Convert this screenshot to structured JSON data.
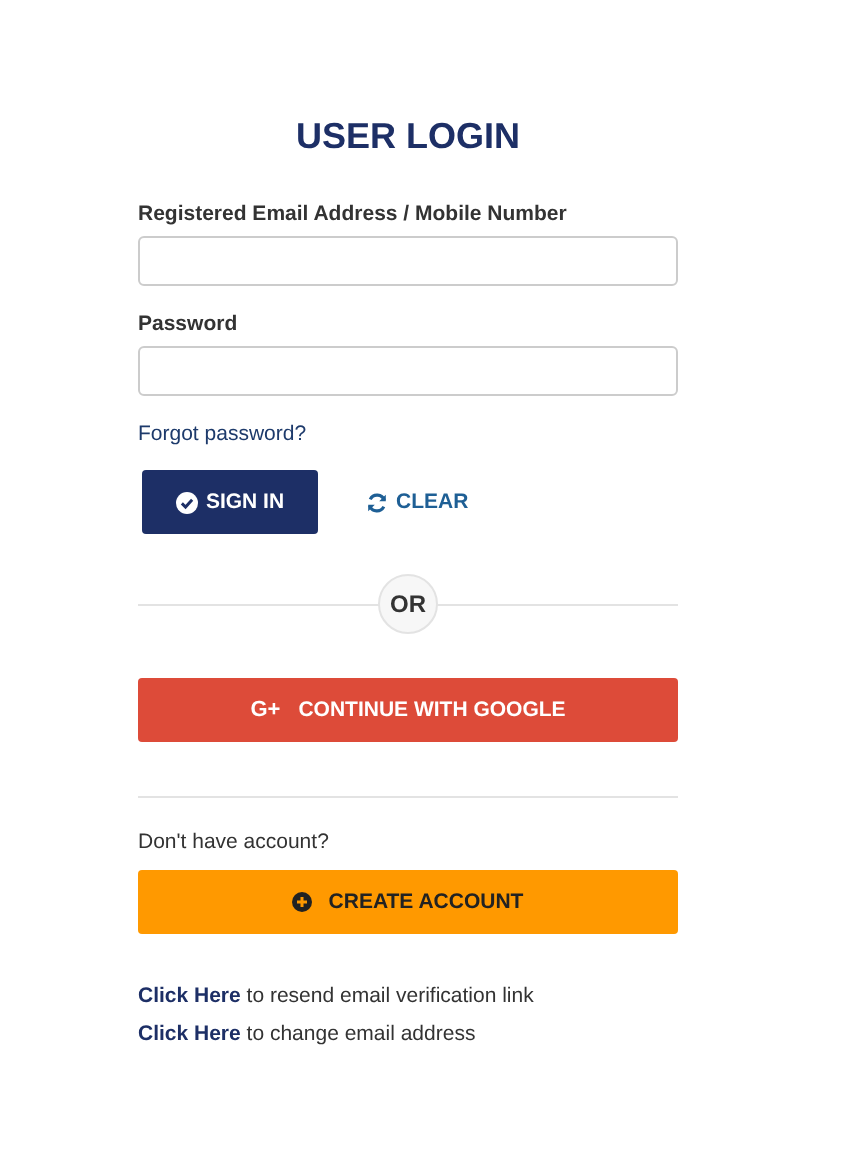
{
  "title": "USER LOGIN",
  "fields": [
    {
      "label": "Registered Email Address / Mobile Number"
    },
    {
      "label": "Password"
    }
  ],
  "forgot_link": "Forgot password?",
  "sign_in": "SIGN IN",
  "clear": "CLEAR",
  "divider_text": "OR",
  "google": {
    "icon": "G+",
    "label": "CONTINUE WITH GOOGLE"
  },
  "no_account": "Don't have account?",
  "create": "CREATE ACCOUNT",
  "links": [
    {
      "link": "Click Here",
      "text": " to resend email verification link"
    },
    {
      "link": "Click Here",
      "text": " to change email address"
    }
  ]
}
